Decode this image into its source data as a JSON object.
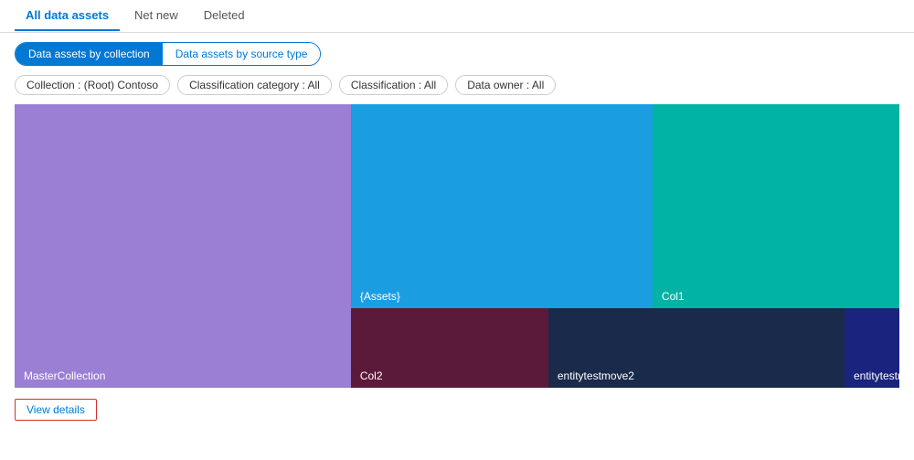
{
  "tabs": {
    "items": [
      {
        "label": "All data assets",
        "active": true
      },
      {
        "label": "Net new",
        "active": false
      },
      {
        "label": "Deleted",
        "active": false
      }
    ]
  },
  "toggle": {
    "left": "Data assets by collection",
    "right": "Data assets by source type"
  },
  "filters": [
    {
      "label": "Collection : (Root) Contoso"
    },
    {
      "label": "Classification category : All"
    },
    {
      "label": "Classification : All"
    },
    {
      "label": "Data owner : All"
    }
  ],
  "treemap": {
    "blocks": [
      {
        "id": "master",
        "label": "MasterCollection"
      },
      {
        "id": "assets",
        "label": "{Assets}"
      },
      {
        "id": "col1",
        "label": "Col1"
      },
      {
        "id": "col2",
        "label": "Col2"
      },
      {
        "id": "entity2",
        "label": "entitytestmove2"
      },
      {
        "id": "entitymov",
        "label": "entitytestmov..."
      }
    ]
  },
  "viewDetails": {
    "label": "View details"
  }
}
